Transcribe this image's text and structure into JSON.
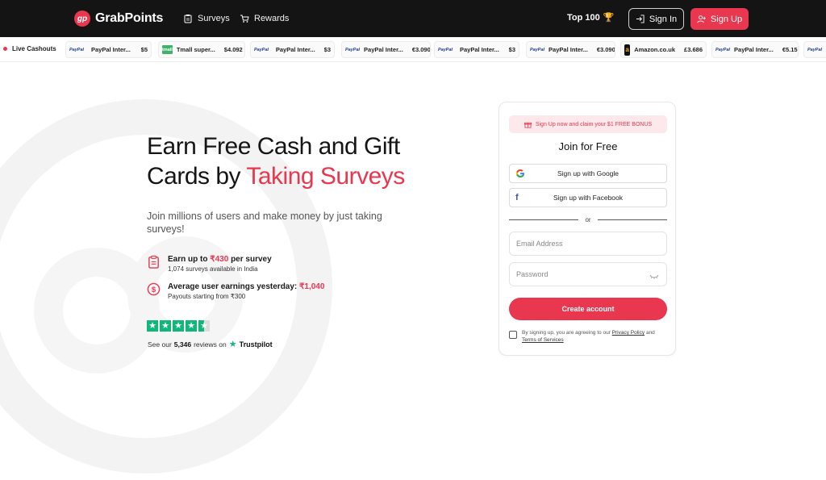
{
  "brand": {
    "name": "GrabPoints",
    "mark": "gp",
    "accent": "#e8374f",
    "nav_bg": "#141414"
  },
  "nav": {
    "surveys": "Surveys",
    "rewards": "Rewards",
    "top100": "Top 100",
    "sign_in": "Sign In",
    "sign_up": "Sign Up"
  },
  "ticker": {
    "label": "Live Cashouts",
    "items": [
      {
        "logo": "PayPal",
        "name": "PayPal Inter...",
        "amount": "$5"
      },
      {
        "logo": "tmall",
        "name": "Tmall super...",
        "amount": "$4.092"
      },
      {
        "logo": "PayPal",
        "name": "PayPal Inter...",
        "amount": "$3"
      },
      {
        "logo": "PayPal",
        "name": "PayPal Inter...",
        "amount": "€3.090"
      },
      {
        "logo": "PayPal",
        "name": "PayPal Inter...",
        "amount": "$3"
      },
      {
        "logo": "PayPal",
        "name": "PayPal Inter...",
        "amount": "€3.090"
      },
      {
        "logo": "amazon",
        "name": "Amazon.co.uk",
        "amount": "£3.686"
      },
      {
        "logo": "PayPal",
        "name": "PayPal Inter...",
        "amount": "€5.151"
      },
      {
        "logo": "PayPal",
        "name": "",
        "amount": ""
      }
    ]
  },
  "hero": {
    "title_plain": "Earn Free Cash and Gift Cards by",
    "title_accent": "Taking Surveys",
    "subtitle": "Join millions of users and make money by just taking surveys!",
    "feature1": {
      "prefix": "Earn up to",
      "amount": "₹430",
      "suffix": "per survey",
      "sub": "1,074 surveys available in India"
    },
    "feature2": {
      "prefix": "Average user earnings yesterday:",
      "amount": "₹1,040",
      "sub": "Payouts starting from ₹300"
    },
    "rating": 4.5,
    "reviews_prefix": "See our",
    "reviews_count": "5,346",
    "reviews_suffix": "reviews on",
    "trustpilot": "Trustpilot"
  },
  "signup": {
    "promo": "Sign Up now and claim your $1 FREE BONUS",
    "title": "Join for Free",
    "google": "Sign up with Google",
    "facebook": "Sign up with Facebook",
    "or": "or",
    "email_placeholder": "Email Address",
    "password_placeholder": "Password",
    "create": "Create account",
    "agree_prefix": "By signing up, you are agreeing to our",
    "privacy": "Privacy Policy",
    "and": "and",
    "terms": "Terms of Services"
  }
}
